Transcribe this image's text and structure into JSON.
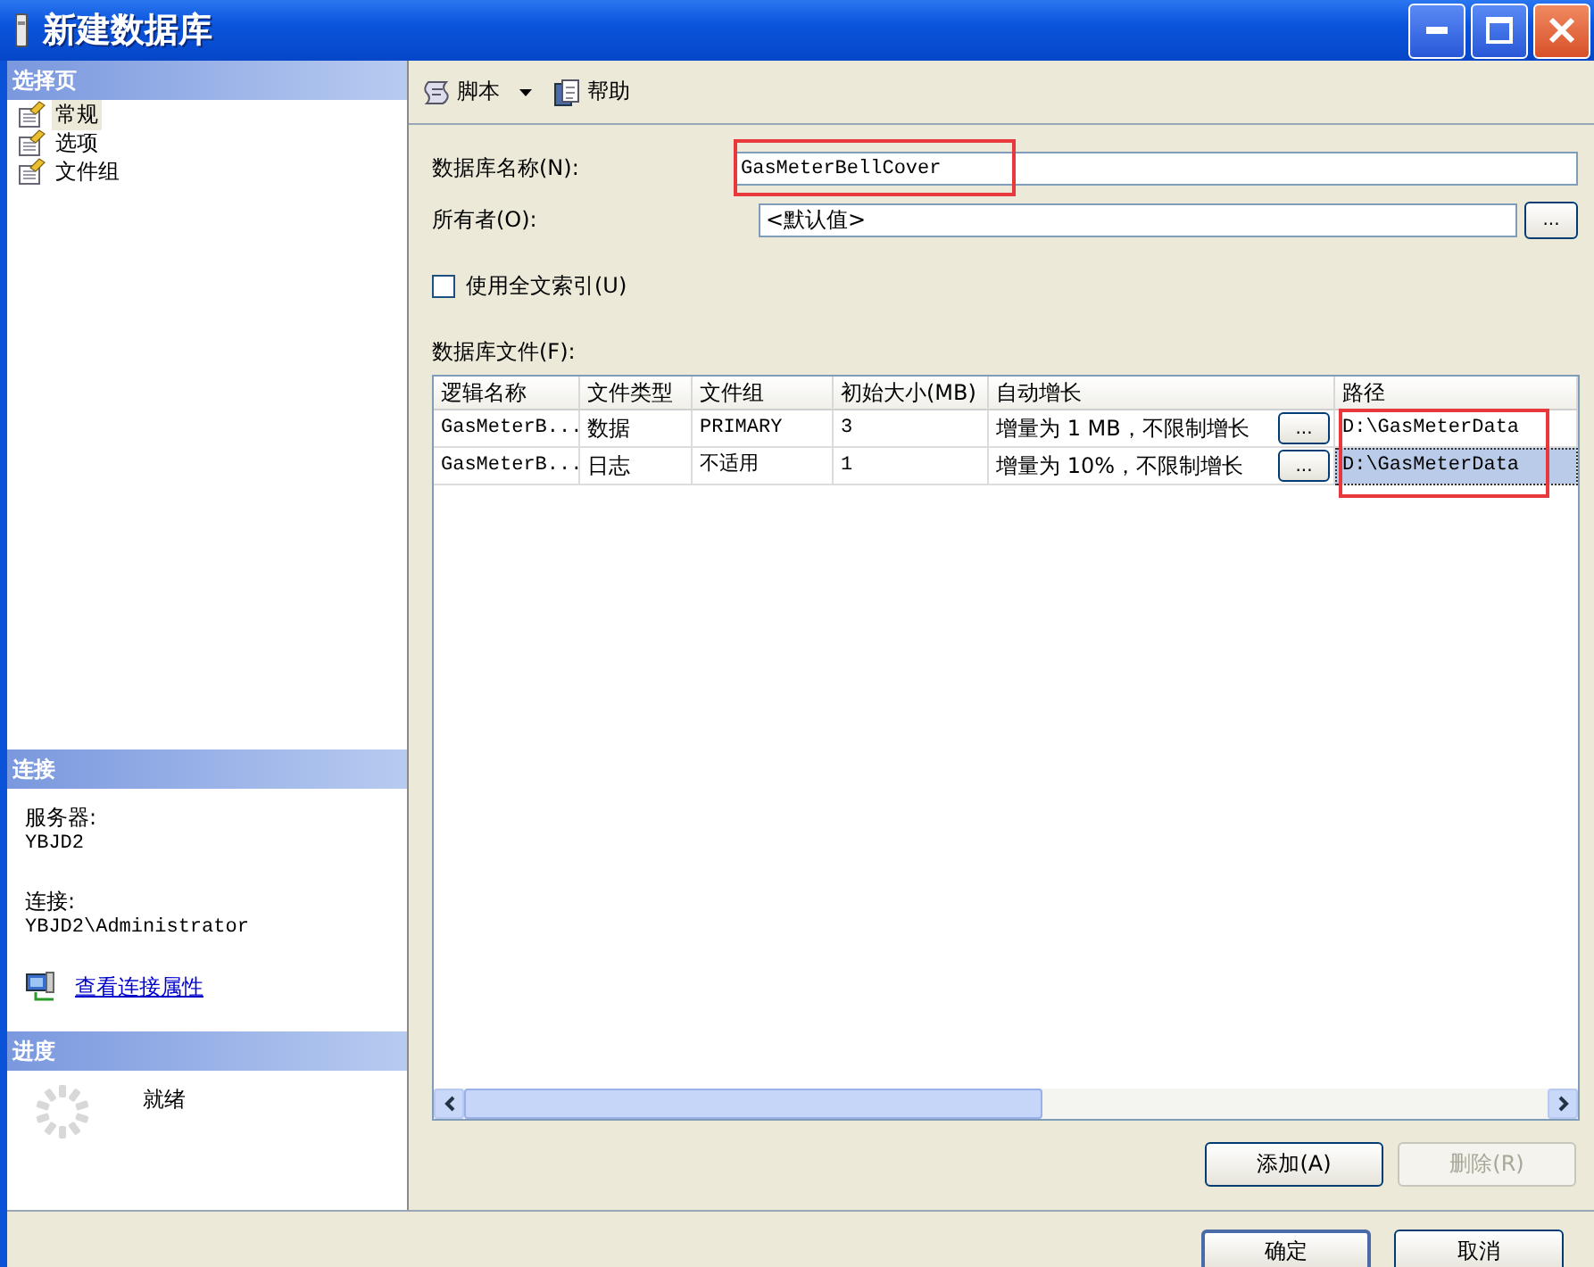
{
  "window": {
    "title": "新建数据库"
  },
  "sidebar": {
    "header": "选择页",
    "items": [
      {
        "label": "常规",
        "selected": true
      },
      {
        "label": "选项",
        "selected": false
      },
      {
        "label": "文件组",
        "selected": false
      }
    ]
  },
  "connection": {
    "header": "连接",
    "server_label": "服务器:",
    "server": "YBJD2",
    "connection_label": "连接:",
    "connection": "YBJD2\\Administrator",
    "link": "查看连接属性"
  },
  "progress": {
    "header": "进度",
    "status": "就绪"
  },
  "toolbar": [
    {
      "label": "脚本",
      "kind": "dropdown"
    },
    {
      "label": "帮助",
      "kind": "help"
    }
  ],
  "form": {
    "name_label": "数据库名称(N):",
    "name_value": "GasMeterBellCover",
    "owner_label": "所有者(O):",
    "owner_value": "<默认值>",
    "browse_button": "...",
    "fulltext": {
      "label": "使用全文索引(U)",
      "checked": false
    }
  },
  "files": {
    "label": "数据库文件(F):",
    "columns": [
      "逻辑名称",
      "文件类型",
      "文件组",
      "初始大小(MB)",
      "自动增长",
      "路径"
    ],
    "rows": [
      {
        "selected": false,
        "cells": [
          "GasMeterB...",
          "数据",
          "PRIMARY",
          "3",
          "增量为 1 MB，不限制增长",
          "D:\\GasMeterData"
        ],
        "button": "..."
      },
      {
        "selected": true,
        "cells": [
          "GasMeterB...",
          "日志",
          "不适用",
          "1",
          "增量为 10%，不限制增长",
          "D:\\GasMeterData"
        ],
        "button": "..."
      }
    ]
  },
  "file_buttons": [
    {
      "label": "添加(A)",
      "disabled": false
    },
    {
      "label": "删除(R)",
      "disabled": true
    }
  ],
  "buttons": [
    {
      "label": "确定",
      "default": true
    },
    {
      "label": "取消",
      "default": false
    }
  ]
}
